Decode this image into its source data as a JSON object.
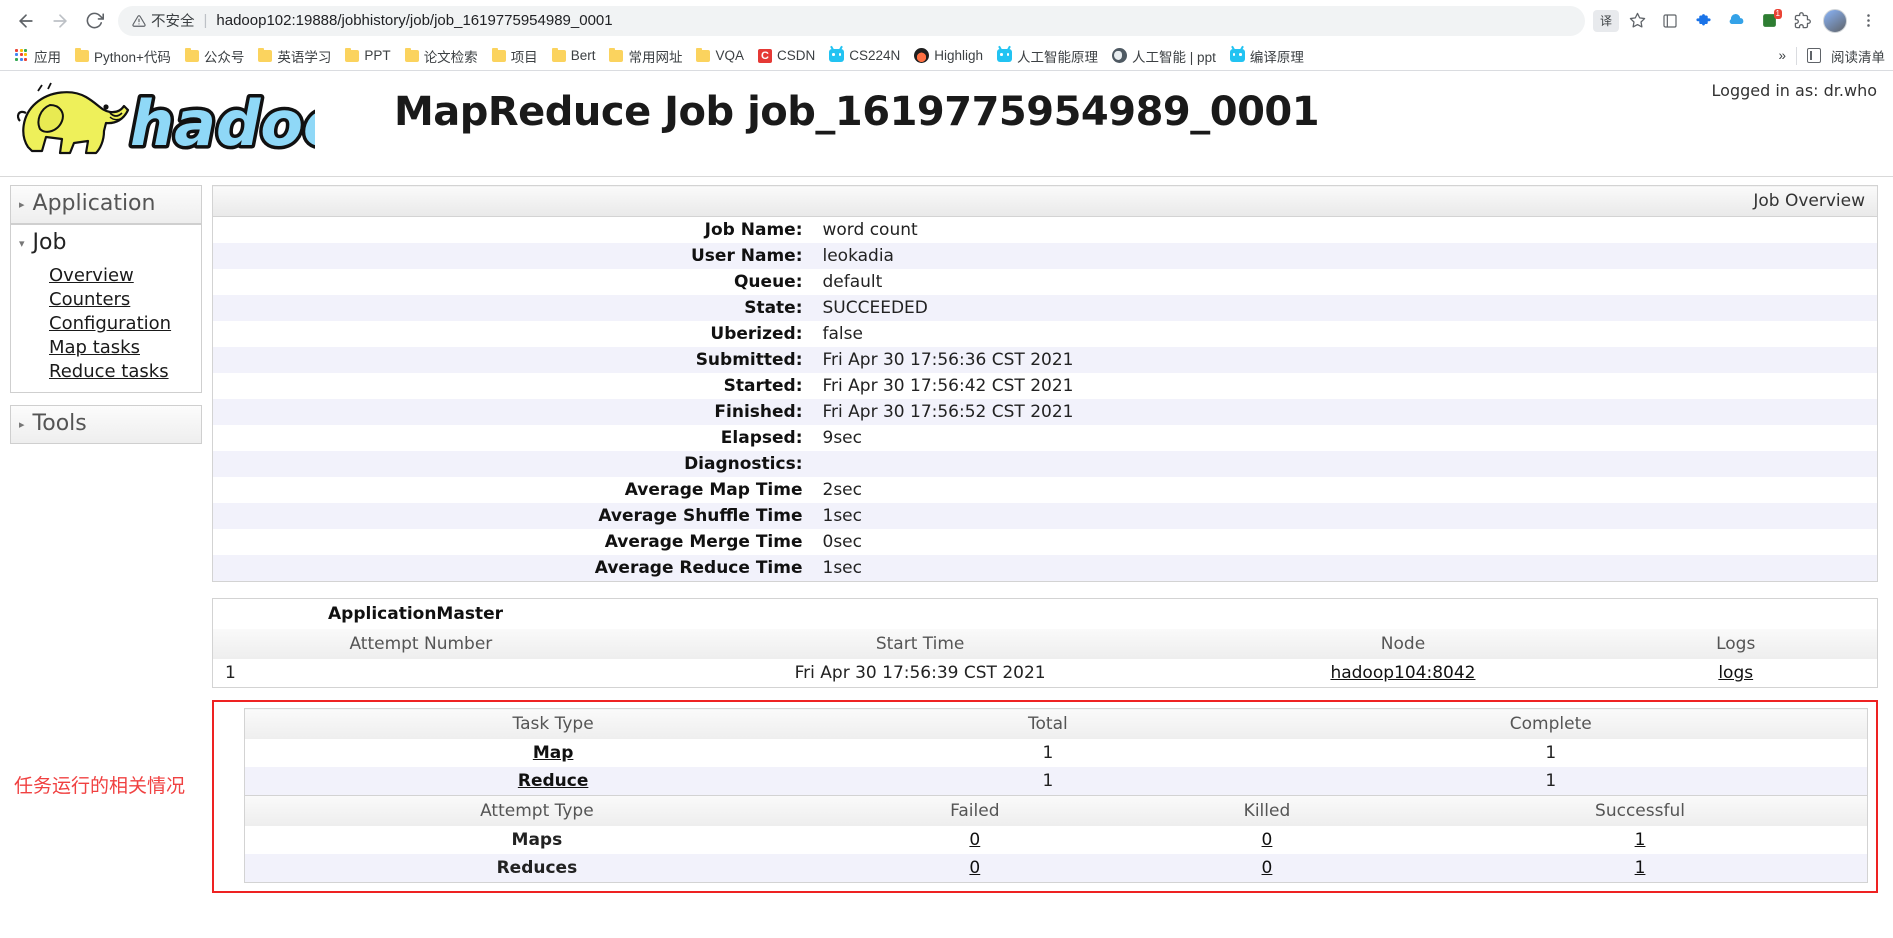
{
  "browser": {
    "back_icon": "back-arrow-icon",
    "forward_icon": "forward-arrow-icon",
    "reload_icon": "reload-icon",
    "security_label": "不安全",
    "url": "hadoop102:19888/jobhistory/job/job_1619775954989_0001",
    "translate_icon": "译",
    "bookmark_star_icon": "star-icon",
    "overflow_label": "»",
    "reading_list_label": "阅读清单"
  },
  "bookmarks": [
    {
      "label": "应用",
      "icon": "apps-grid-icon"
    },
    {
      "label": "Python+代码",
      "icon": "folder-icon"
    },
    {
      "label": "公众号",
      "icon": "folder-icon"
    },
    {
      "label": "英语学习",
      "icon": "folder-icon"
    },
    {
      "label": "PPT",
      "icon": "folder-icon"
    },
    {
      "label": "论文检索",
      "icon": "folder-icon"
    },
    {
      "label": "项目",
      "icon": "folder-icon"
    },
    {
      "label": "Bert",
      "icon": "folder-icon"
    },
    {
      "label": "常用网址",
      "icon": "folder-icon"
    },
    {
      "label": "VQA",
      "icon": "folder-icon"
    },
    {
      "label": "CSDN",
      "icon": "csdn-icon"
    },
    {
      "label": "CS224N",
      "icon": "bilibili-icon"
    },
    {
      "label": "Highligh",
      "icon": "flame-icon"
    },
    {
      "label": "人工智能原理",
      "icon": "bilibili-icon"
    },
    {
      "label": "人工智能 | ppt",
      "icon": "globe-icon"
    },
    {
      "label": "编译原理",
      "icon": "bilibili-icon"
    }
  ],
  "header": {
    "logo_alt": "hadoop",
    "title": "MapReduce Job job_1619775954989_0001",
    "logged_in_as": "Logged in as: dr.who"
  },
  "sidebar": {
    "application": {
      "label": "Application",
      "triangle": "▸"
    },
    "job": {
      "label": "Job",
      "triangle": "▾"
    },
    "job_links": [
      {
        "label": "Overview"
      },
      {
        "label": "Counters"
      },
      {
        "label": "Configuration"
      },
      {
        "label": "Map tasks"
      },
      {
        "label": "Reduce tasks"
      }
    ],
    "tools": {
      "label": "Tools",
      "triangle": "▸"
    }
  },
  "job_overview": {
    "caption": "Job Overview",
    "rows": [
      {
        "label": "Job Name:",
        "value": "word count"
      },
      {
        "label": "User Name:",
        "value": "leokadia"
      },
      {
        "label": "Queue:",
        "value": "default"
      },
      {
        "label": "State:",
        "value": "SUCCEEDED"
      },
      {
        "label": "Uberized:",
        "value": "false"
      },
      {
        "label": "Submitted:",
        "value": "Fri Apr 30 17:56:36 CST 2021"
      },
      {
        "label": "Started:",
        "value": "Fri Apr 30 17:56:42 CST 2021"
      },
      {
        "label": "Finished:",
        "value": "Fri Apr 30 17:56:52 CST 2021"
      },
      {
        "label": "Elapsed:",
        "value": "9sec"
      },
      {
        "label": "Diagnostics:",
        "value": ""
      },
      {
        "label": "Average Map Time",
        "value": "2sec"
      },
      {
        "label": "Average Shuffle Time",
        "value": "1sec"
      },
      {
        "label": "Average Merge Time",
        "value": "0sec"
      },
      {
        "label": "Average Reduce Time",
        "value": "1sec"
      }
    ]
  },
  "application_master": {
    "title": "ApplicationMaster",
    "columns": [
      "Attempt Number",
      "Start Time",
      "Node",
      "Logs"
    ],
    "rows": [
      {
        "attempt": "1",
        "start_time": "Fri Apr 30 17:56:39 CST 2021",
        "node": "hadoop104:8042",
        "logs": "logs"
      }
    ]
  },
  "task_summary": {
    "task_columns": [
      "Task Type",
      "Total",
      "Complete"
    ],
    "task_rows": [
      {
        "type": "Map",
        "total": "1",
        "complete": "1"
      },
      {
        "type": "Reduce",
        "total": "1",
        "complete": "1"
      }
    ],
    "attempt_columns": [
      "Attempt Type",
      "Failed",
      "Killed",
      "Successful"
    ],
    "attempt_rows": [
      {
        "type": "Maps",
        "failed": "0",
        "killed": "0",
        "successful": "1"
      },
      {
        "type": "Reduces",
        "failed": "0",
        "killed": "0",
        "successful": "1"
      }
    ]
  },
  "annotation": {
    "text": "任务运行的相关情况",
    "color": "#f04141",
    "box_color": "#ee2222"
  }
}
